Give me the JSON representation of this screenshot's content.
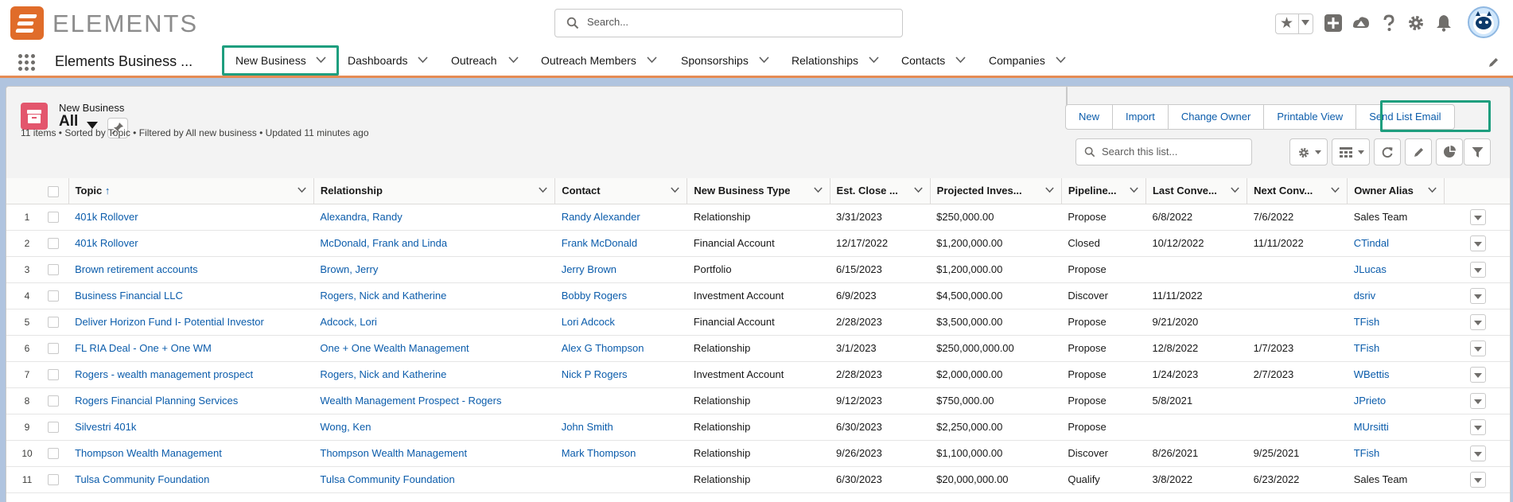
{
  "app": {
    "brand": "ELEMENTS",
    "app_name": "Elements Business ...",
    "search_placeholder": "Search..."
  },
  "nav": {
    "items": [
      {
        "label": "New Business",
        "active": true
      },
      {
        "label": "Dashboards"
      },
      {
        "label": "Outreach"
      },
      {
        "label": "Outreach Members"
      },
      {
        "label": "Sponsorships"
      },
      {
        "label": "Relationships"
      },
      {
        "label": "Contacts"
      },
      {
        "label": "Companies"
      }
    ]
  },
  "list": {
    "object_name": "New Business",
    "view_name": "All",
    "meta": "11 items • Sorted by Topic • Filtered by All new business • Updated 11 minutes ago",
    "buttons": [
      "New",
      "Import",
      "Change Owner",
      "Printable View",
      "Send List Email"
    ],
    "search_placeholder": "Search this list..."
  },
  "table": {
    "columns": [
      "Topic",
      "Relationship",
      "Contact",
      "New Business Type",
      "Est. Close ...",
      "Projected Inves...",
      "Pipeline...",
      "Last Conve...",
      "Next Conv...",
      "Owner Alias"
    ],
    "sort_indicator": "↑",
    "rows": [
      {
        "n": "1",
        "topic": "401k Rollover",
        "relationship": "Alexandra, Randy",
        "contact": "Randy Alexander",
        "type": "Relationship",
        "close": "3/31/2023",
        "invest": "$250,000.00",
        "pipeline": "Propose",
        "last": "6/8/2022",
        "next": "7/6/2022",
        "owner": "Sales Team",
        "owner_link": false
      },
      {
        "n": "2",
        "topic": "401k Rollover",
        "relationship": "McDonald, Frank and Linda",
        "contact": "Frank McDonald",
        "type": "Financial Account",
        "close": "12/17/2022",
        "invest": "$1,200,000.00",
        "pipeline": "Closed",
        "last": "10/12/2022",
        "next": "11/11/2022",
        "owner": "CTindal",
        "owner_link": true
      },
      {
        "n": "3",
        "topic": "Brown retirement accounts",
        "relationship": "Brown, Jerry",
        "contact": "Jerry Brown",
        "type": "Portfolio",
        "close": "6/15/2023",
        "invest": "$1,200,000.00",
        "pipeline": "Propose",
        "last": "",
        "next": "",
        "owner": "JLucas",
        "owner_link": true
      },
      {
        "n": "4",
        "topic": "Business Financial LLC",
        "relationship": "Rogers, Nick and Katherine",
        "contact": "Bobby Rogers",
        "type": "Investment Account",
        "close": "6/9/2023",
        "invest": "$4,500,000.00",
        "pipeline": "Discover",
        "last": "11/11/2022",
        "next": "",
        "owner": "dsriv",
        "owner_link": true
      },
      {
        "n": "5",
        "topic": "Deliver Horizon Fund I- Potential Investor",
        "relationship": "Adcock, Lori",
        "contact": "Lori Adcock",
        "type": "Financial Account",
        "close": "2/28/2023",
        "invest": "$3,500,000.00",
        "pipeline": "Propose",
        "last": "9/21/2020",
        "next": "",
        "owner": "TFish",
        "owner_link": true
      },
      {
        "n": "6",
        "topic": "FL RIA Deal - One + One WM",
        "relationship": "One + One Wealth Management",
        "contact": "Alex G Thompson",
        "type": "Relationship",
        "close": "3/1/2023",
        "invest": "$250,000,000.00",
        "pipeline": "Propose",
        "last": "12/8/2022",
        "next": "1/7/2023",
        "owner": "TFish",
        "owner_link": true
      },
      {
        "n": "7",
        "topic": "Rogers - wealth management prospect",
        "relationship": "Rogers, Nick and Katherine",
        "contact": "Nick P Rogers",
        "type": "Investment Account",
        "close": "2/28/2023",
        "invest": "$2,000,000.00",
        "pipeline": "Propose",
        "last": "1/24/2023",
        "next": "2/7/2023",
        "owner": "WBettis",
        "owner_link": true
      },
      {
        "n": "8",
        "topic": "Rogers Financial Planning Services",
        "relationship": "Wealth Management Prospect - Rogers",
        "contact": "",
        "type": "Relationship",
        "close": "9/12/2023",
        "invest": "$750,000.00",
        "pipeline": "Propose",
        "last": "5/8/2021",
        "next": "",
        "owner": "JPrieto",
        "owner_link": true
      },
      {
        "n": "9",
        "topic": "Silvestri 401k",
        "relationship": "Wong, Ken",
        "contact": "John Smith",
        "type": "Relationship",
        "close": "6/30/2023",
        "invest": "$2,250,000.00",
        "pipeline": "Propose",
        "last": "",
        "next": "",
        "owner": "MUrsitti",
        "owner_link": true
      },
      {
        "n": "10",
        "topic": "Thompson Wealth Management",
        "relationship": "Thompson Wealth Management",
        "contact": "Mark Thompson",
        "type": "Relationship",
        "close": "9/26/2023",
        "invest": "$1,100,000.00",
        "pipeline": "Discover",
        "last": "8/26/2021",
        "next": "9/25/2021",
        "owner": "TFish",
        "owner_link": true
      },
      {
        "n": "11",
        "topic": "Tulsa Community Foundation",
        "relationship": "Tulsa Community Foundation",
        "contact": "",
        "type": "Relationship",
        "close": "6/30/2023",
        "invest": "$20,000,000.00",
        "pipeline": "Qualify",
        "last": "3/8/2022",
        "next": "6/23/2022",
        "owner": "Sales Team",
        "owner_link": false
      }
    ]
  },
  "colors": {
    "brand_orange": "#e06c2a",
    "nav_underline": "#e58b54",
    "highlight_green": "#1e9e7e",
    "link_blue": "#0b5cab",
    "object_icon": "#e3566d"
  },
  "icons": [
    "search-icon",
    "star-icon",
    "add-icon",
    "trailhead-icon",
    "help-icon",
    "gear-icon",
    "bell-icon",
    "waffle-icon",
    "pencil-icon",
    "pin-icon",
    "refresh-icon",
    "chart-icon",
    "filter-icon",
    "table-icon"
  ]
}
